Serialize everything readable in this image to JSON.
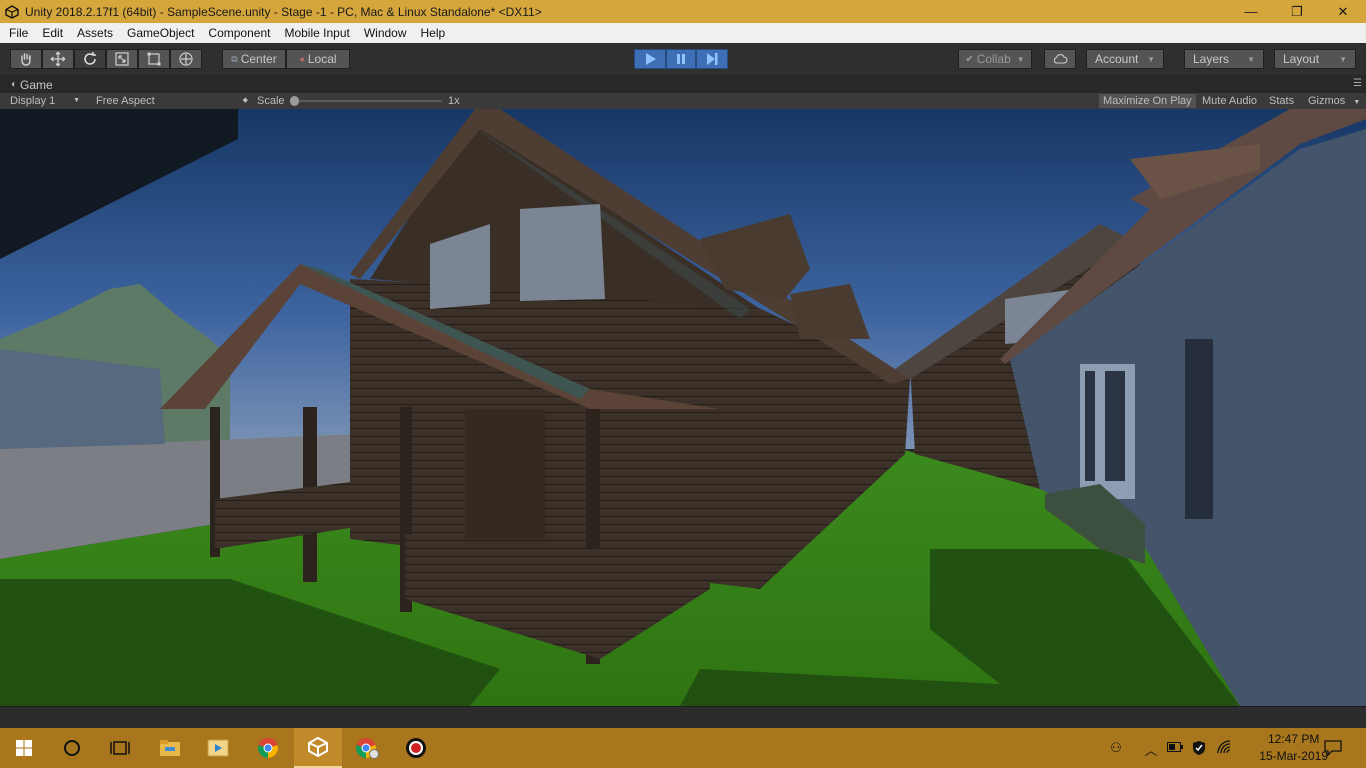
{
  "window": {
    "title": "Unity 2018.2.17f1 (64bit) - SampleScene.unity - Stage -1 - PC, Mac & Linux Standalone* <DX11>",
    "minimize_glyph": "—",
    "restore_glyph": "❐",
    "close_glyph": "✕"
  },
  "menu": [
    "File",
    "Edit",
    "Assets",
    "GameObject",
    "Component",
    "Mobile Input",
    "Window",
    "Help"
  ],
  "toolbar": {
    "tools": [
      "hand-tool-icon",
      "move-tool-icon",
      "rotate-tool-icon",
      "scale-tool-icon",
      "rect-tool-icon",
      "transform-tool-icon"
    ],
    "pivot_label": "Center",
    "space_label": "Local",
    "collab_label": "Collab",
    "account_label": "Account",
    "layers_label": "Layers",
    "layout_label": "Layout"
  },
  "game_view": {
    "tab_label": "Game",
    "display_label": "Display 1",
    "aspect_label": "Free Aspect",
    "scale_label": "Scale",
    "scale_value": "1x",
    "maximize_label": "Maximize On Play",
    "mute_label": "Mute Audio",
    "stats_label": "Stats",
    "gizmos_label": "Gizmos"
  },
  "taskbar": {
    "time": "12:47 PM",
    "date": "15-Mar-2019",
    "apps": [
      "start-icon",
      "cortana-icon",
      "task-view-icon",
      "file-explorer-icon",
      "media-player-icon",
      "chrome-icon",
      "unity-icon",
      "chrome-profile-icon",
      "recorder-icon"
    ]
  },
  "colors": {
    "title_bar": "#d4a63b",
    "play_active": "#3e6fb5",
    "taskbar": "#a7761d",
    "sky": "#2f5588",
    "grass": "#3f8c1f"
  }
}
